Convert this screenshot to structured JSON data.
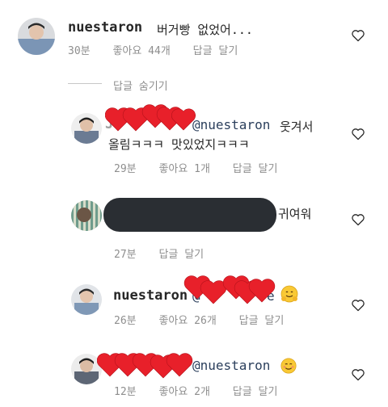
{
  "comments": [
    {
      "username": "nuestaron",
      "text": "버거빵 없었어...",
      "time": "30분",
      "likes": "좋아요 44개",
      "reply": "답글 달기"
    },
    {
      "username": "J",
      "mention": "@nuestaron",
      "text_tail": "웃겨서",
      "text_line2": "올림ㅋㅋㅋ 맛있었지ㅋㅋㅋ",
      "time": "29분",
      "likes": "좋아요 1개",
      "reply": "답글 달기"
    },
    {
      "text_tail": "귀여워",
      "time": "27분",
      "reply": "답글 달기"
    },
    {
      "username": "nuestaron",
      "mention": "@",
      "mention_tail": "e",
      "time": "26분",
      "likes": "좋아요 26개",
      "reply": "답글 달기"
    },
    {
      "mention": "@nuestaron",
      "time": "12분",
      "likes": "좋아요 2개",
      "reply": "답글 달기"
    }
  ],
  "hide_replies": "답글 숨기기",
  "colors": {
    "text": "#262626",
    "meta": "#8e8e8e",
    "mention": "#2b3f5c",
    "heart_emoji": "#e8202a"
  },
  "icons": [
    "heart-outline-icon",
    "red-heart-emoji",
    "hugging-face-emoji",
    "smiling-face-emoji"
  ]
}
